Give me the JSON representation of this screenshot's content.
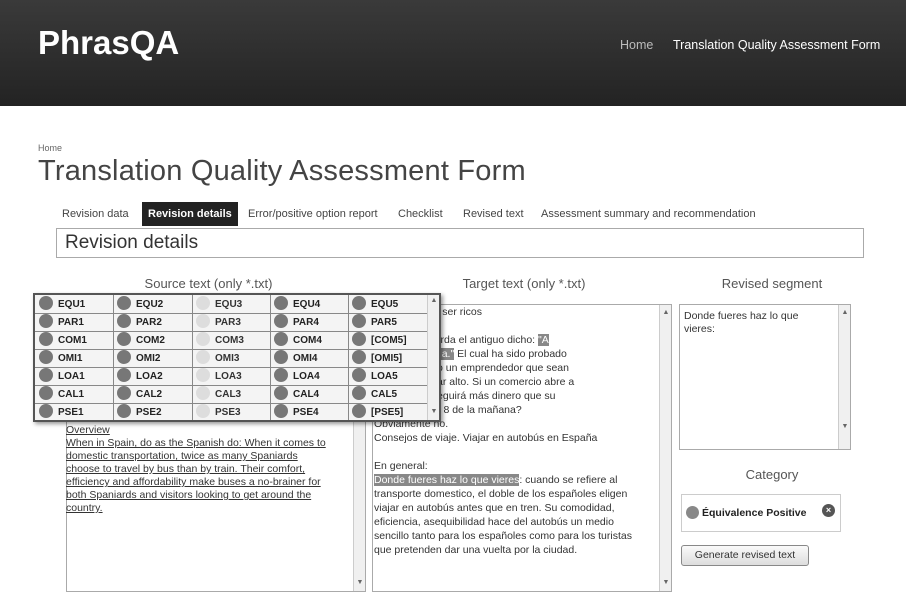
{
  "app": {
    "brand": "PhrasQA"
  },
  "nav": {
    "home": "Home",
    "form": "Translation Quality Assessment Form"
  },
  "breadcrumb": "Home",
  "page_title": "Translation Quality Assessment Form",
  "tabs": [
    "Revision data",
    "Revision details",
    "Error/positive option report",
    "Checklist",
    "Revised text",
    "Assessment summary and recommendation"
  ],
  "active_tab": "Revision details",
  "section_title": "Revision details",
  "columns": {
    "source": "Source text (only *.txt)",
    "target": "Target text (only *.txt)",
    "revised": "Revised segment"
  },
  "grid_rows": [
    [
      "EQU1",
      "EQU2",
      "EQU3",
      "EQU4",
      "EQU5"
    ],
    [
      "PAR1",
      "PAR2",
      "PAR3",
      "PAR4",
      "PAR5"
    ],
    [
      "COM1",
      "COM2",
      "COM3",
      "COM4",
      "[COM5]"
    ],
    [
      "OMI1",
      "OMI2",
      "OMI3",
      "OMI4",
      "[OMI5]"
    ],
    [
      "LOA1",
      "LOA2",
      "LOA3",
      "LOA4",
      "LOA5"
    ],
    [
      "CAL1",
      "CAL2",
      "CAL3",
      "CAL4",
      "CAL5"
    ],
    [
      "PSE1",
      "PSE2",
      "PSE3",
      "PSE4",
      "[PSE5]"
    ]
  ],
  "source_text": {
    "heading": "Overview",
    "lines": [
      "When in Spain, do as the Spanish do: When it comes to",
      "domestic transportation, twice as many Spaniards",
      "choose to travel by bus than by train. Their comfort,",
      "efficiency and affordability make buses a no-brainer for",
      "both Spaniards and visitors looking to get around the",
      "country."
    ]
  },
  "target_text": {
    "lines": [
      "es no llegan a ser ricos",
      "",
      "l mundo recuerda el antiguo dicho: ",
      "a, dios le ayuda.",
      " El cual ha sido probado",
      "Un pensador o un emprendedor que sean",
      "o pueden llegar alto. Si un comercio abre a",
      "diodía, ¿conseguirá más dinero que su",
      " que abre a las 8 de la mañana?",
      "Obviamente no.",
      "Consejos de viaje. Viajar en autobús en España",
      "",
      "En general:",
      "Donde fueres haz lo que vieres",
      ": cuando se refiere al",
      "transporte domestico, el doble de los españoles eligen",
      "viajar en autobús antes que en tren. Su comodidad,",
      "eficiencia, asequibilidad hace del autobús un medio",
      "sencillo tanto para los españoles como para los turistas",
      "que pretenden dar una vuelta por la ciudad."
    ],
    "highlight_1": "\"A",
    "highlight_2": "a, dios le ayuda.\""
  },
  "revised_segment": "Donde fueres haz lo que vieres:",
  "category": {
    "heading": "Category",
    "value": "Équivalence Positive",
    "remove_glyph": "×"
  },
  "generate_button": "Generate revised text"
}
